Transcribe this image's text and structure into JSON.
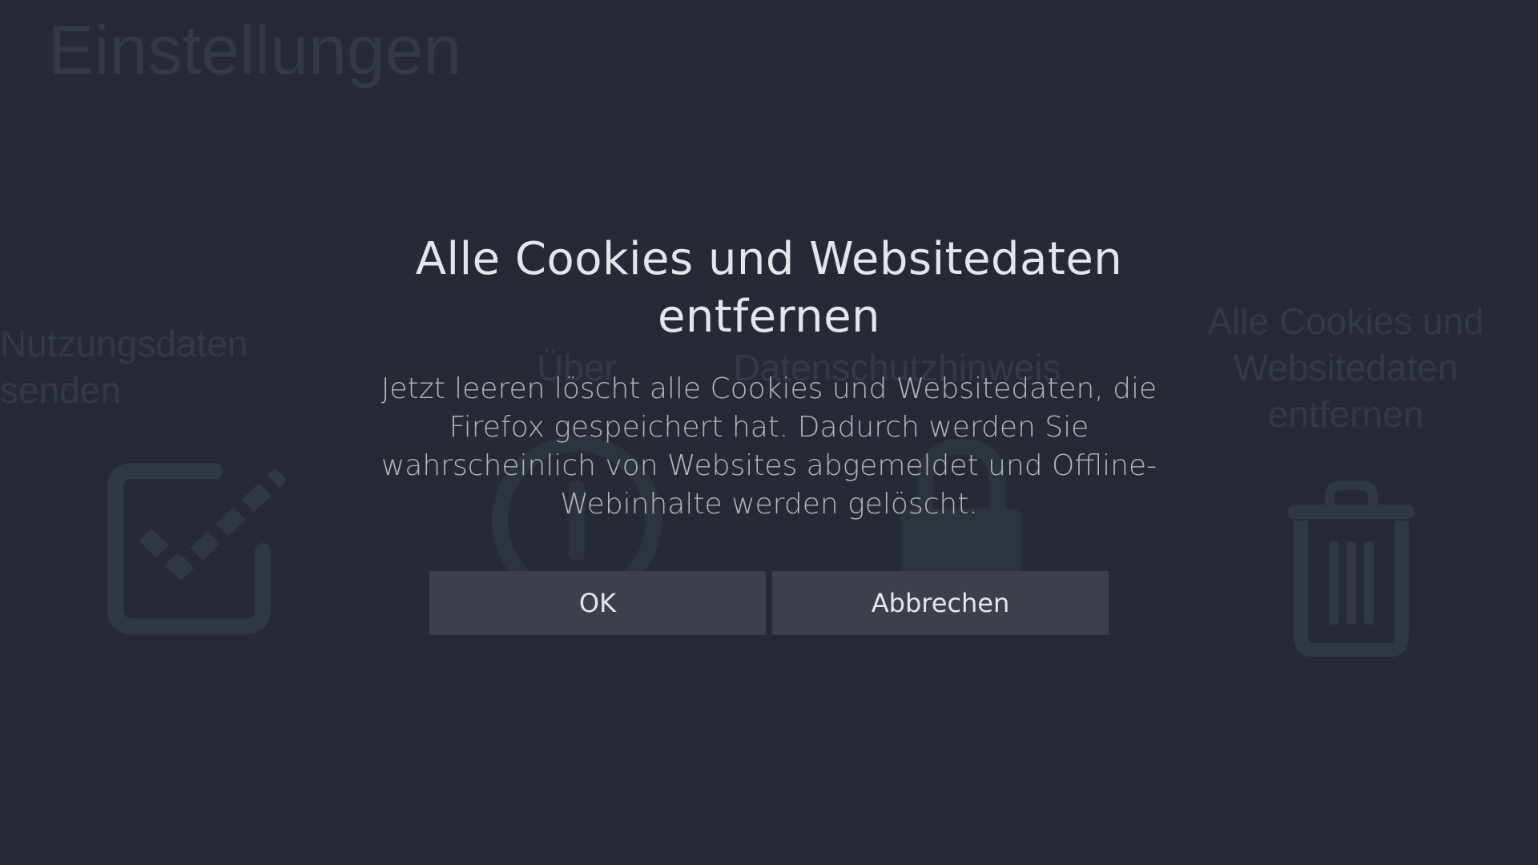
{
  "background": {
    "page_title": "Einstellungen",
    "tiles": [
      {
        "label": "Nutzungsdaten senden",
        "icon": "checkbox-check-icon"
      },
      {
        "label": "Über",
        "icon": "info-icon"
      },
      {
        "label": "Datenschutzhinweis",
        "icon": "lock-icon"
      },
      {
        "label": "Alle Cookies und Websitedaten entfernen",
        "icon": "trash-icon"
      }
    ]
  },
  "dialog": {
    "title": "Alle Cookies und Websitedaten entfernen",
    "message": "Jetzt leeren löscht alle Cookies und Websitedaten, die Firefox gespeichert hat. Dadurch werden Sie wahrscheinlich von Websites abgemeldet und Offline-Webinhalte werden gelöscht.",
    "ok_label": "OK",
    "cancel_label": "Abbrechen"
  },
  "colors": {
    "background": "#252a35",
    "button": "#3b404a",
    "title_text": "#e4e6e9",
    "body_text": "#b3b7be",
    "dimmed_text": "#343a45"
  }
}
